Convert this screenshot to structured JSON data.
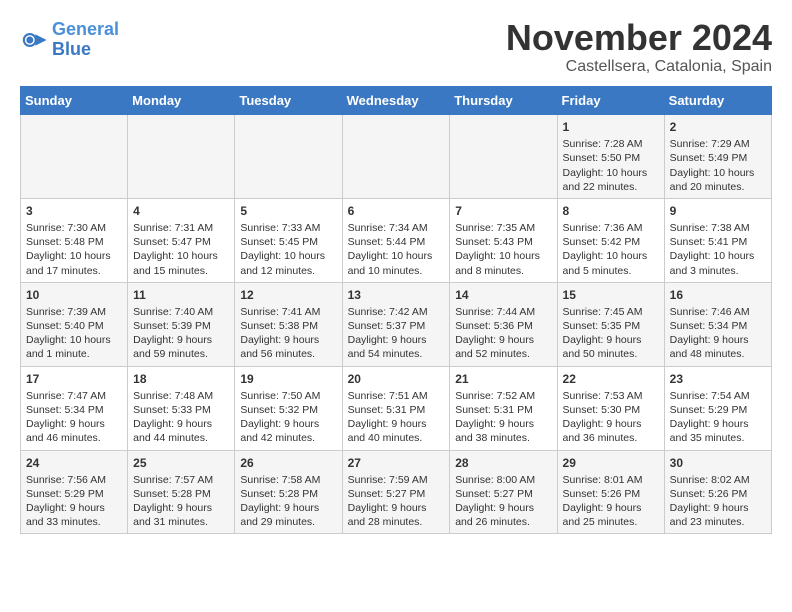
{
  "logo": {
    "text1": "General",
    "text2": "Blue"
  },
  "title": "November 2024",
  "location": "Castellsera, Catalonia, Spain",
  "weekdays": [
    "Sunday",
    "Monday",
    "Tuesday",
    "Wednesday",
    "Thursday",
    "Friday",
    "Saturday"
  ],
  "rows": [
    [
      {
        "day": "",
        "info": ""
      },
      {
        "day": "",
        "info": ""
      },
      {
        "day": "",
        "info": ""
      },
      {
        "day": "",
        "info": ""
      },
      {
        "day": "",
        "info": ""
      },
      {
        "day": "1",
        "info": "Sunrise: 7:28 AM\nSunset: 5:50 PM\nDaylight: 10 hours and 22 minutes."
      },
      {
        "day": "2",
        "info": "Sunrise: 7:29 AM\nSunset: 5:49 PM\nDaylight: 10 hours and 20 minutes."
      }
    ],
    [
      {
        "day": "3",
        "info": "Sunrise: 7:30 AM\nSunset: 5:48 PM\nDaylight: 10 hours and 17 minutes."
      },
      {
        "day": "4",
        "info": "Sunrise: 7:31 AM\nSunset: 5:47 PM\nDaylight: 10 hours and 15 minutes."
      },
      {
        "day": "5",
        "info": "Sunrise: 7:33 AM\nSunset: 5:45 PM\nDaylight: 10 hours and 12 minutes."
      },
      {
        "day": "6",
        "info": "Sunrise: 7:34 AM\nSunset: 5:44 PM\nDaylight: 10 hours and 10 minutes."
      },
      {
        "day": "7",
        "info": "Sunrise: 7:35 AM\nSunset: 5:43 PM\nDaylight: 10 hours and 8 minutes."
      },
      {
        "day": "8",
        "info": "Sunrise: 7:36 AM\nSunset: 5:42 PM\nDaylight: 10 hours and 5 minutes."
      },
      {
        "day": "9",
        "info": "Sunrise: 7:38 AM\nSunset: 5:41 PM\nDaylight: 10 hours and 3 minutes."
      }
    ],
    [
      {
        "day": "10",
        "info": "Sunrise: 7:39 AM\nSunset: 5:40 PM\nDaylight: 10 hours and 1 minute."
      },
      {
        "day": "11",
        "info": "Sunrise: 7:40 AM\nSunset: 5:39 PM\nDaylight: 9 hours and 59 minutes."
      },
      {
        "day": "12",
        "info": "Sunrise: 7:41 AM\nSunset: 5:38 PM\nDaylight: 9 hours and 56 minutes."
      },
      {
        "day": "13",
        "info": "Sunrise: 7:42 AM\nSunset: 5:37 PM\nDaylight: 9 hours and 54 minutes."
      },
      {
        "day": "14",
        "info": "Sunrise: 7:44 AM\nSunset: 5:36 PM\nDaylight: 9 hours and 52 minutes."
      },
      {
        "day": "15",
        "info": "Sunrise: 7:45 AM\nSunset: 5:35 PM\nDaylight: 9 hours and 50 minutes."
      },
      {
        "day": "16",
        "info": "Sunrise: 7:46 AM\nSunset: 5:34 PM\nDaylight: 9 hours and 48 minutes."
      }
    ],
    [
      {
        "day": "17",
        "info": "Sunrise: 7:47 AM\nSunset: 5:34 PM\nDaylight: 9 hours and 46 minutes."
      },
      {
        "day": "18",
        "info": "Sunrise: 7:48 AM\nSunset: 5:33 PM\nDaylight: 9 hours and 44 minutes."
      },
      {
        "day": "19",
        "info": "Sunrise: 7:50 AM\nSunset: 5:32 PM\nDaylight: 9 hours and 42 minutes."
      },
      {
        "day": "20",
        "info": "Sunrise: 7:51 AM\nSunset: 5:31 PM\nDaylight: 9 hours and 40 minutes."
      },
      {
        "day": "21",
        "info": "Sunrise: 7:52 AM\nSunset: 5:31 PM\nDaylight: 9 hours and 38 minutes."
      },
      {
        "day": "22",
        "info": "Sunrise: 7:53 AM\nSunset: 5:30 PM\nDaylight: 9 hours and 36 minutes."
      },
      {
        "day": "23",
        "info": "Sunrise: 7:54 AM\nSunset: 5:29 PM\nDaylight: 9 hours and 35 minutes."
      }
    ],
    [
      {
        "day": "24",
        "info": "Sunrise: 7:56 AM\nSunset: 5:29 PM\nDaylight: 9 hours and 33 minutes."
      },
      {
        "day": "25",
        "info": "Sunrise: 7:57 AM\nSunset: 5:28 PM\nDaylight: 9 hours and 31 minutes."
      },
      {
        "day": "26",
        "info": "Sunrise: 7:58 AM\nSunset: 5:28 PM\nDaylight: 9 hours and 29 minutes."
      },
      {
        "day": "27",
        "info": "Sunrise: 7:59 AM\nSunset: 5:27 PM\nDaylight: 9 hours and 28 minutes."
      },
      {
        "day": "28",
        "info": "Sunrise: 8:00 AM\nSunset: 5:27 PM\nDaylight: 9 hours and 26 minutes."
      },
      {
        "day": "29",
        "info": "Sunrise: 8:01 AM\nSunset: 5:26 PM\nDaylight: 9 hours and 25 minutes."
      },
      {
        "day": "30",
        "info": "Sunrise: 8:02 AM\nSunset: 5:26 PM\nDaylight: 9 hours and 23 minutes."
      }
    ]
  ]
}
